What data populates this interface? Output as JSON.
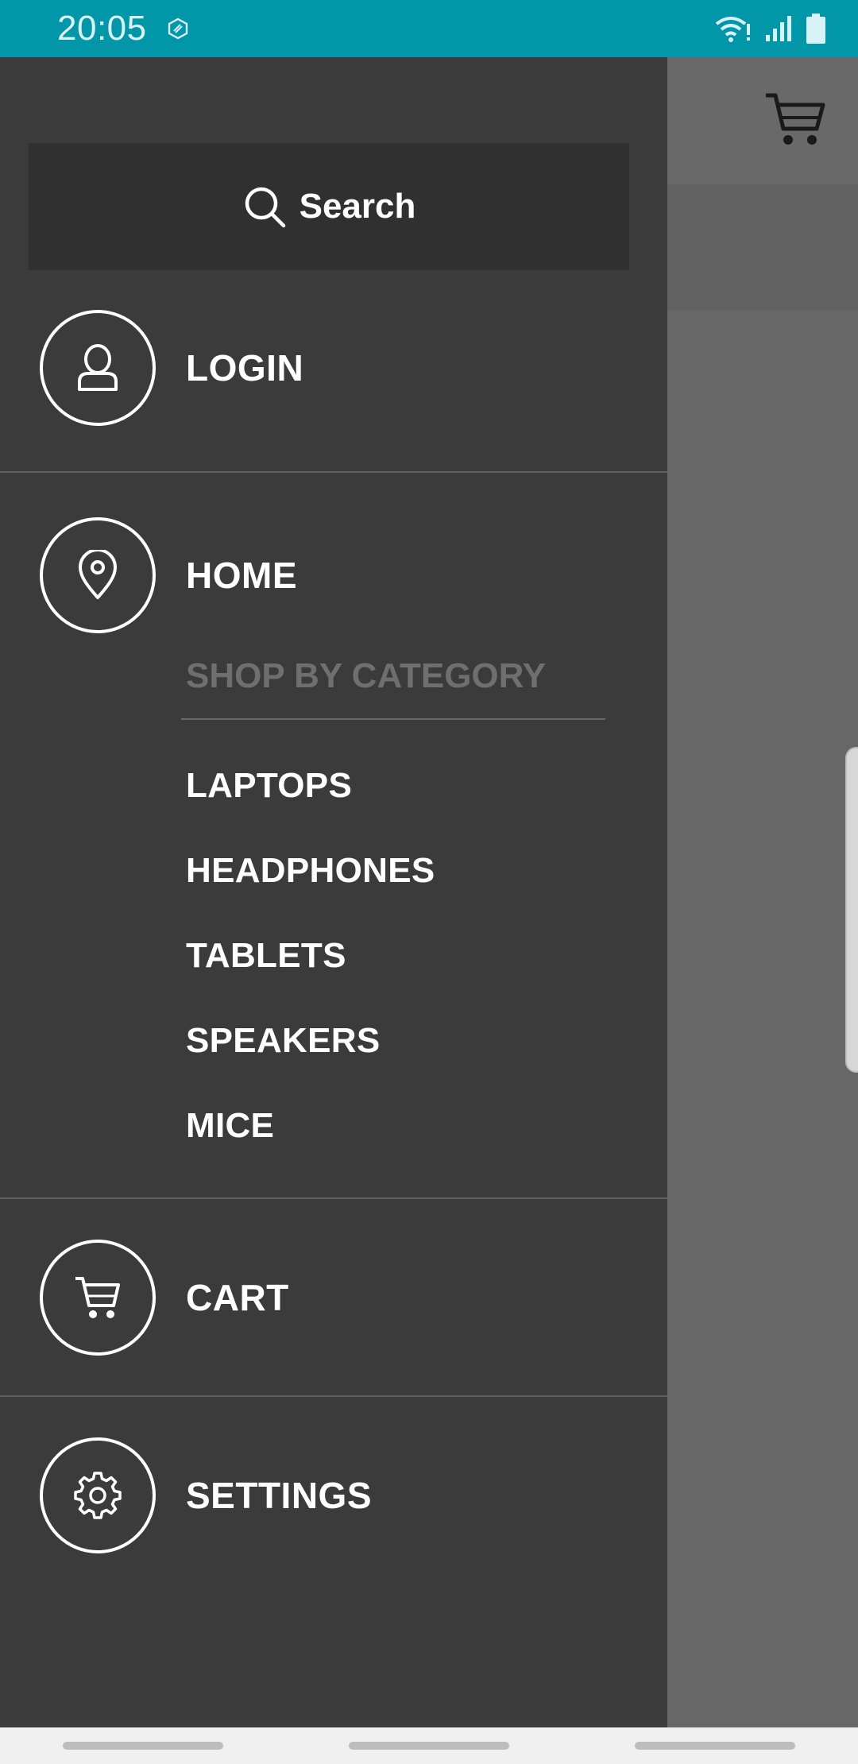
{
  "status_bar": {
    "time": "20:05",
    "app_icon": "fireball-icon",
    "indicators": [
      "wifi-icon",
      "signal-icon",
      "battery-icon"
    ],
    "color": "#0196a8"
  },
  "background_app": {
    "cart_icon": "cart-icon"
  },
  "drawer": {
    "search": {
      "icon": "search-icon",
      "label": "Search"
    },
    "login": {
      "icon": "user-icon",
      "label": "LOGIN"
    },
    "home": {
      "icon": "location-pin-icon",
      "label": "HOME"
    },
    "category_header": "SHOP BY CATEGORY",
    "categories": [
      "LAPTOPS",
      "HEADPHONES",
      "TABLETS",
      "SPEAKERS",
      "MICE"
    ],
    "cart": {
      "icon": "cart-icon",
      "label": "CART"
    },
    "settings": {
      "icon": "gear-icon",
      "label": "SETTINGS"
    },
    "background_color": "#3b3b3b"
  },
  "nav_bar": {
    "buttons": [
      "recents",
      "home",
      "back"
    ]
  }
}
